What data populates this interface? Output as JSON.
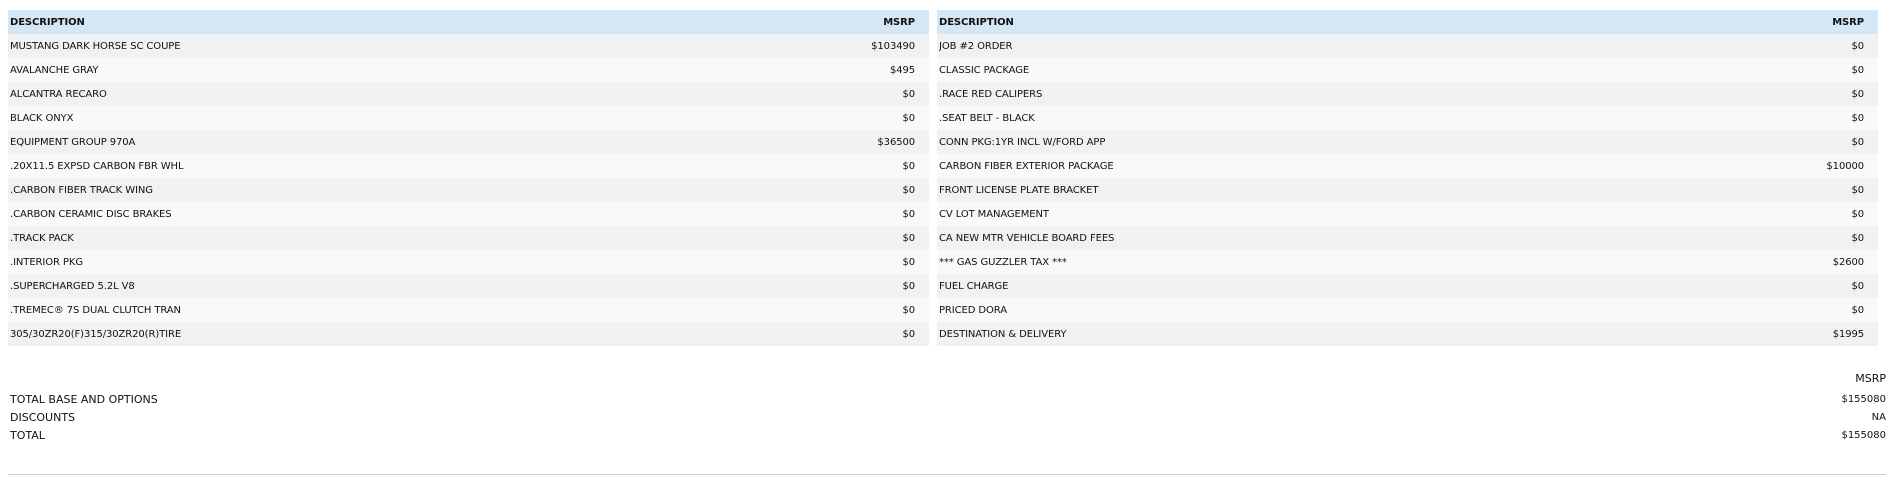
{
  "left_table": {
    "header": {
      "description": "DESCRIPTION",
      "msrp": "MSRP"
    },
    "rows": [
      {
        "description": "MUSTANG DARK HORSE SC COUPE",
        "msrp": "$103490"
      },
      {
        "description": "AVALANCHE GRAY",
        "msrp": "$495"
      },
      {
        "description": "ALCANTRA RECARO",
        "msrp": "$0"
      },
      {
        "description": "BLACK ONYX",
        "msrp": "$0"
      },
      {
        "description": "EQUIPMENT GROUP 970A",
        "msrp": "$36500"
      },
      {
        "description": ".20X11.5 EXPSD CARBON FBR WHL",
        "msrp": "$0"
      },
      {
        "description": ".CARBON FIBER TRACK WING",
        "msrp": "$0"
      },
      {
        "description": ".CARBON CERAMIC DISC BRAKES",
        "msrp": "$0"
      },
      {
        "description": ".TRACK PACK",
        "msrp": "$0"
      },
      {
        "description": ".INTERIOR PKG",
        "msrp": "$0"
      },
      {
        "description": ".SUPERCHARGED 5.2L V8",
        "msrp": "$0"
      },
      {
        "description": ".TREMEC® 7S DUAL CLUTCH TRAN",
        "msrp": "$0"
      },
      {
        "description": "305/30ZR20(F)315/30ZR20(R)TIRE",
        "msrp": "$0"
      }
    ]
  },
  "right_table": {
    "header": {
      "description": "DESCRIPTION",
      "msrp": "MSRP"
    },
    "rows": [
      {
        "description": "JOB #2 ORDER",
        "msrp": "$0"
      },
      {
        "description": "CLASSIC PACKAGE",
        "msrp": "$0"
      },
      {
        "description": ".RACE RED CALIPERS",
        "msrp": "$0"
      },
      {
        "description": ".SEAT BELT - BLACK",
        "msrp": "$0"
      },
      {
        "description": "CONN PKG:1YR INCL W/FORD APP",
        "msrp": "$0"
      },
      {
        "description": "CARBON FIBER EXTERIOR PACKAGE",
        "msrp": "$10000"
      },
      {
        "description": "FRONT LICENSE PLATE BRACKET",
        "msrp": "$0"
      },
      {
        "description": "CV LOT MANAGEMENT",
        "msrp": "$0"
      },
      {
        "description": "CA NEW MTR VEHICLE BOARD FEES",
        "msrp": "$0"
      },
      {
        "description": "*** GAS GUZZLER TAX ***",
        "msrp": "$2600"
      },
      {
        "description": "FUEL CHARGE",
        "msrp": "$0"
      },
      {
        "description": "PRICED DORA",
        "msrp": "$0"
      },
      {
        "description": "DESTINATION & DELIVERY",
        "msrp": "$1995"
      }
    ]
  },
  "totals": {
    "header": "MSRP",
    "rows": [
      {
        "label": "TOTAL BASE AND OPTIONS",
        "value": "$155080"
      },
      {
        "label": "DISCOUNTS",
        "value": "NA"
      },
      {
        "label": "TOTAL",
        "value": "$155080"
      }
    ]
  }
}
